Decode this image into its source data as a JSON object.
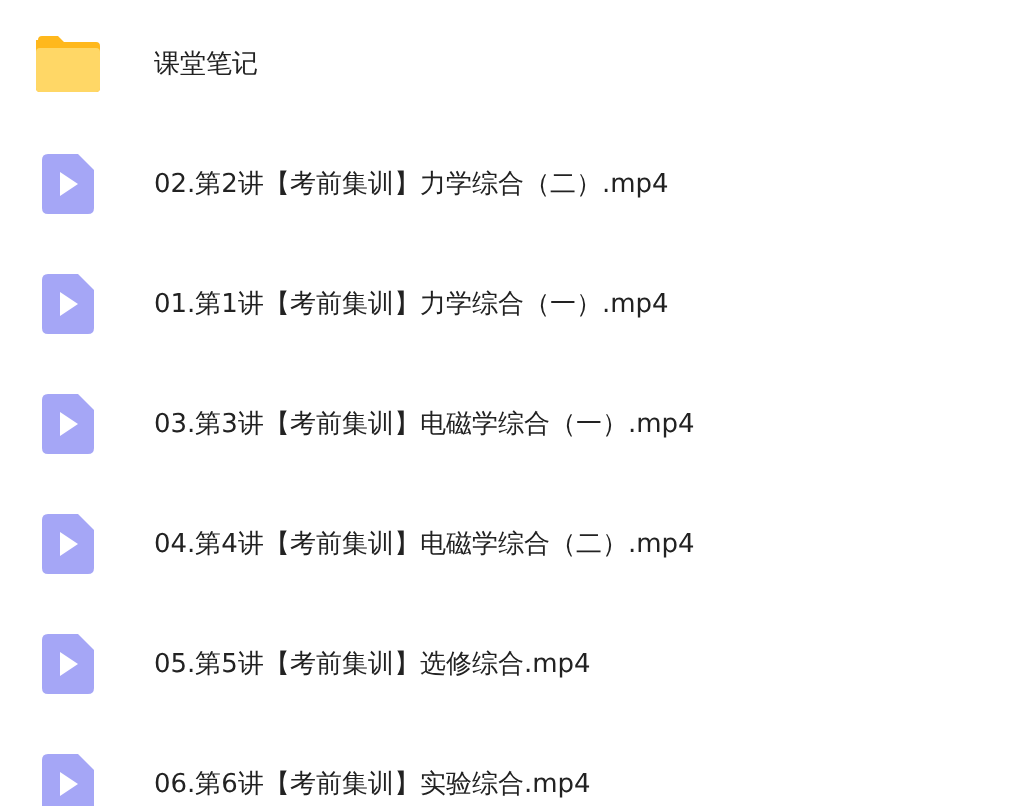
{
  "files": [
    {
      "kind": "folder",
      "name": "课堂笔记"
    },
    {
      "kind": "video",
      "name": "02.第2讲【考前集训】力学综合（二）.mp4"
    },
    {
      "kind": "video",
      "name": "01.第1讲【考前集训】力学综合（一）.mp4"
    },
    {
      "kind": "video",
      "name": "03.第3讲【考前集训】电磁学综合（一）.mp4"
    },
    {
      "kind": "video",
      "name": "04.第4讲【考前集训】电磁学综合（二）.mp4"
    },
    {
      "kind": "video",
      "name": "05.第5讲【考前集训】选修综合.mp4"
    },
    {
      "kind": "video",
      "name": "06.第6讲【考前集训】实验综合.mp4"
    }
  ]
}
